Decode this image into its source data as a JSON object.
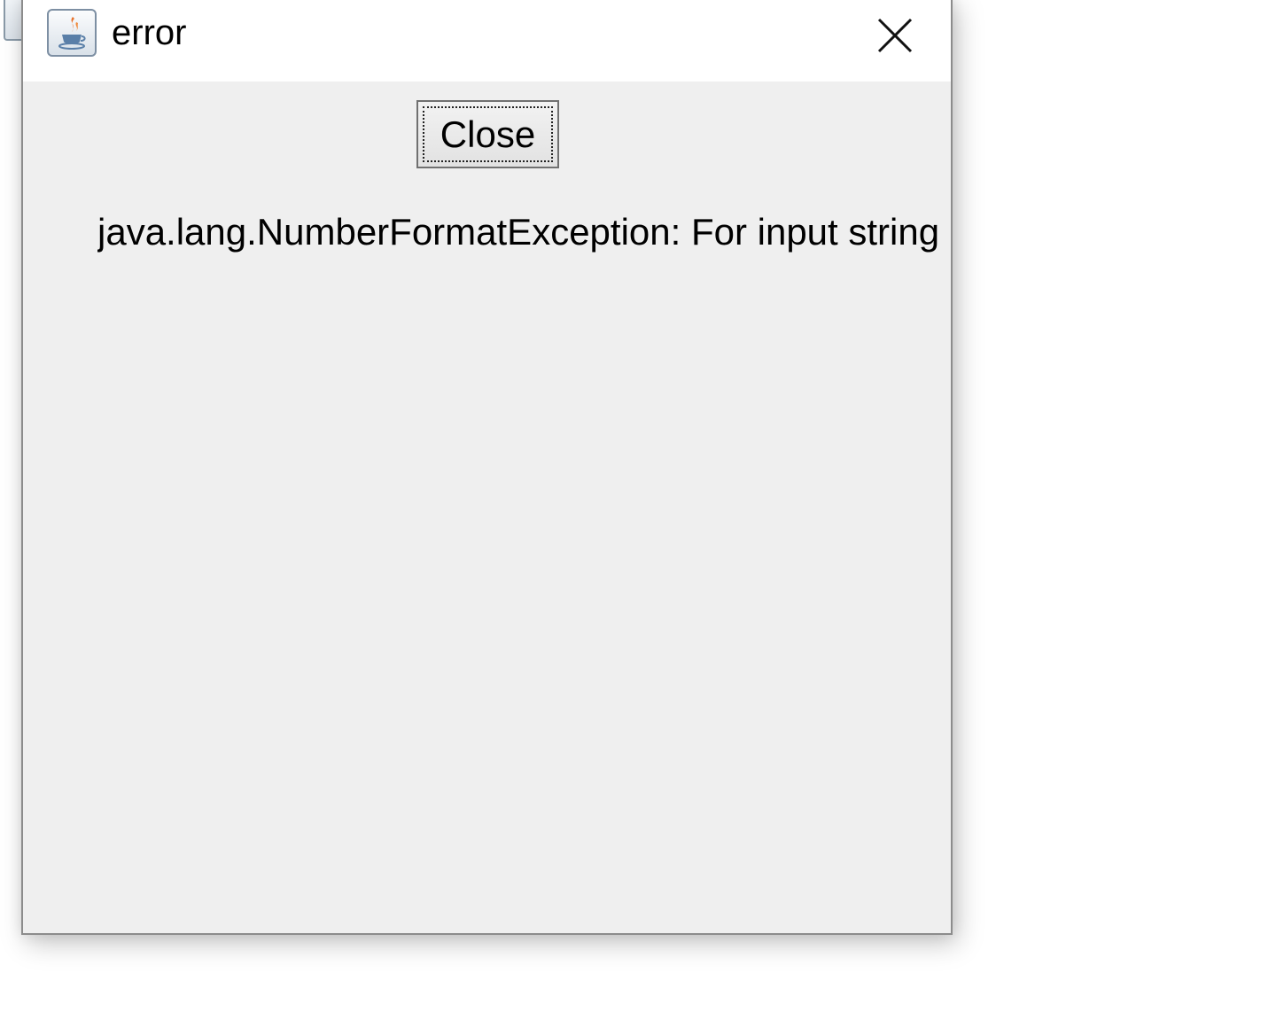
{
  "window": {
    "title": "error",
    "title_icon": "java-icon",
    "close_icon": "close-icon"
  },
  "dialog": {
    "close_button_label": "Close",
    "message": "java.lang.NumberFormatException: For input string"
  },
  "colors": {
    "window_background": "#efefef",
    "titlebar_background": "#ffffff",
    "border": "#8c8c8c"
  }
}
